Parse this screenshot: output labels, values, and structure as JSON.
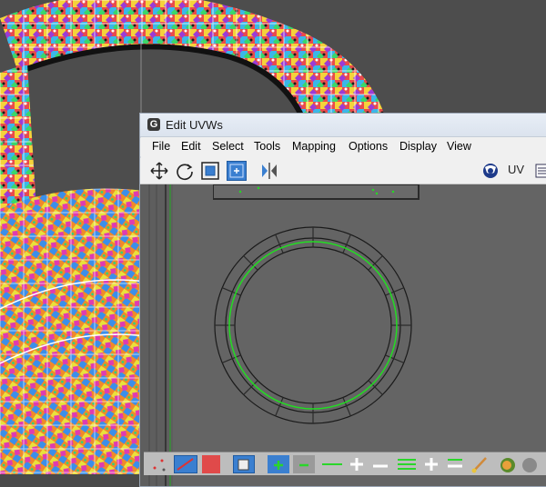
{
  "window": {
    "title": "Edit UVWs",
    "app_icon_glyph": "G",
    "icon_name": "3dsmax-icon"
  },
  "menu": {
    "items": [
      "File",
      "Edit",
      "Select",
      "Tools",
      "Mapping",
      "Options",
      "Display",
      "View"
    ]
  },
  "toolbar": {
    "uv_label": "UV",
    "icons": [
      "move-icon",
      "rotate-icon",
      "scale-icon",
      "freeform-icon",
      "mirror-icon",
      "checker-map-icon",
      "list-icon"
    ]
  },
  "bottom_toolbar": {
    "icons": [
      "vertex-select-icon",
      "edge-select-icon",
      "face-select-icon",
      "element-select-icon",
      "grow-select-icon",
      "shrink-select-icon",
      "loop-icon",
      "ring-icon",
      "expand-icon",
      "contract-icon",
      "paint-select-icon",
      "sphere-icon"
    ]
  },
  "colors": {
    "accent": "#3a7fd0",
    "uv_edge": "#1a1a1a",
    "uv_seam": "#22dd22",
    "editor_bg": "#646464"
  }
}
